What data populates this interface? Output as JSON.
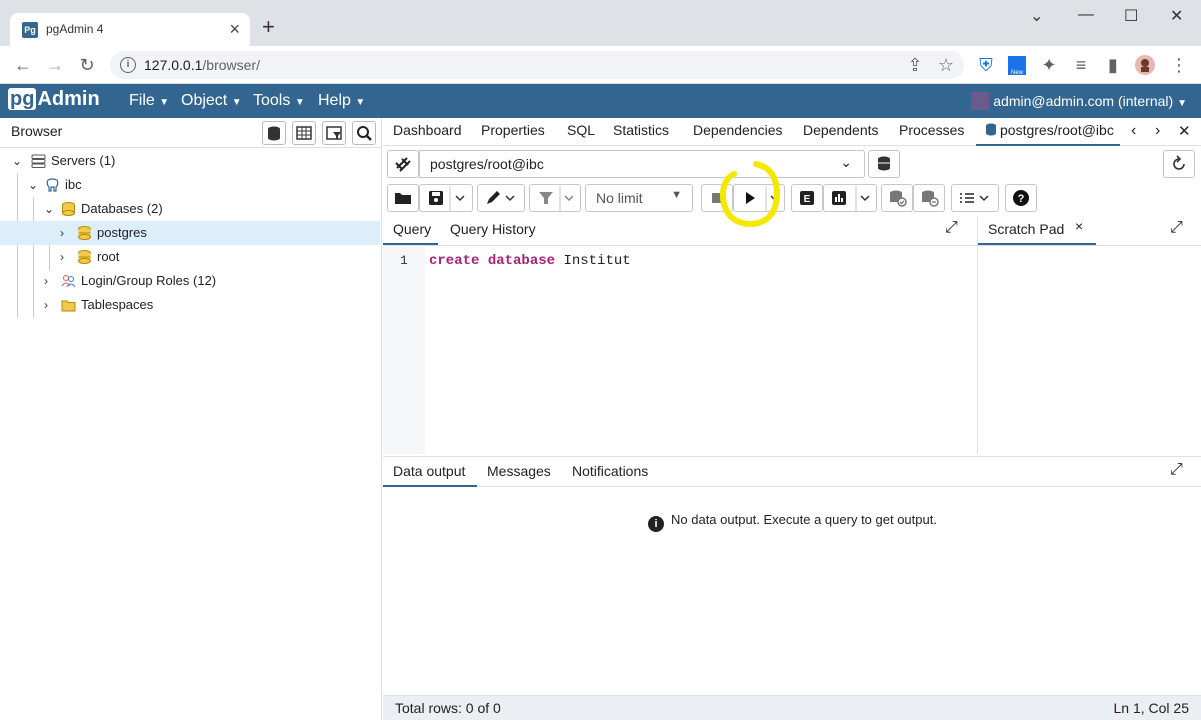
{
  "browser": {
    "tab_title": "pgAdmin 4",
    "favicon_text": "Pg",
    "url_host": "127.0.0.1",
    "url_path": "/browser/"
  },
  "pgadmin": {
    "logo_pg": "pg",
    "logo_admin": "Admin",
    "menus": [
      "File",
      "Object",
      "Tools",
      "Help"
    ],
    "user": "admin@admin.com (internal)"
  },
  "left_panel": {
    "title": "Browser",
    "tree": [
      {
        "label": "Servers (1)"
      },
      {
        "label": "ibc"
      },
      {
        "label": "Databases (2)"
      },
      {
        "label": "postgres"
      },
      {
        "label": "root"
      },
      {
        "label": "Login/Group Roles (12)"
      },
      {
        "label": "Tablespaces"
      }
    ]
  },
  "main_tabs": [
    "Dashboard",
    "Properties",
    "SQL",
    "Statistics",
    "Dependencies",
    "Dependents",
    "Processes",
    "postgres/root@ibc"
  ],
  "query_tool": {
    "connection": "postgres/root@ibc",
    "limit": "No limit",
    "panel_tabs": [
      "Query",
      "Query History"
    ],
    "scratch_tab": "Scratch Pad",
    "line_number": "1",
    "code_kw1": "create",
    "code_kw2": "database",
    "code_ident": "Institut"
  },
  "output": {
    "tabs": [
      "Data Output",
      "Messages",
      "Notifications"
    ],
    "tab_labels": [
      "Data output",
      "Messages",
      "Notifications"
    ],
    "message": "No data output. Execute a query to get output.",
    "total_rows": "Total rows: 0 of 0",
    "cursor": "Ln 1, Col 25"
  },
  "colors": {
    "pgadmin_blue": "#326690",
    "highlight": "#f5e800",
    "selected_row": "#dbeefa",
    "keyword": "#a3247a"
  }
}
